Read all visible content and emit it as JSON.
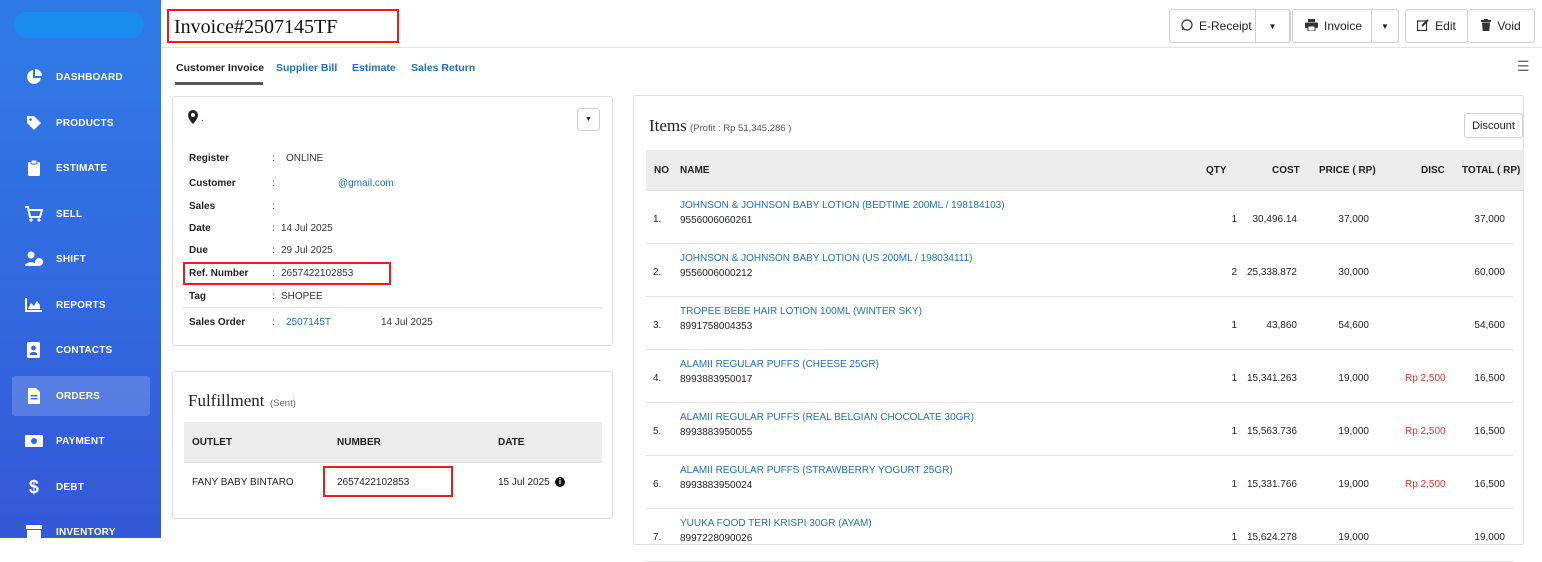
{
  "nav": [
    {
      "label": "DASHBOARD",
      "icon": "pie-chart-icon"
    },
    {
      "label": "PRODUCTS",
      "icon": "tag-icon"
    },
    {
      "label": "ESTIMATE",
      "icon": "clipboard-icon"
    },
    {
      "label": "SELL",
      "icon": "cart-icon"
    },
    {
      "label": "SHIFT",
      "icon": "user-clock-icon"
    },
    {
      "label": "REPORTS",
      "icon": "area-chart-icon"
    },
    {
      "label": "CONTACTS",
      "icon": "address-book-icon"
    },
    {
      "label": "ORDERS",
      "icon": "file-icon"
    },
    {
      "label": "PAYMENT",
      "icon": "money-icon"
    },
    {
      "label": "DEBT",
      "icon": "dollar-icon"
    },
    {
      "label": "INVENTORY",
      "icon": "archive-icon"
    }
  ],
  "header": {
    "title": "Invoice#2507145TF",
    "ereceipt": "E-Receipt",
    "invoice": "Invoice",
    "edit": "Edit",
    "void": "Void"
  },
  "tabs": [
    "Customer Invoice",
    "Supplier Bill",
    "Estimate",
    "Sales Return"
  ],
  "info": {
    "location": ".",
    "register_label": "Register",
    "register": "ONLINE",
    "customer_label": "Customer",
    "customer": "@gmail.com",
    "sales_label": "Sales",
    "sales": "",
    "date_label": "Date",
    "date": "14 Jul 2025",
    "due_label": "Due",
    "due": "29 Jul 2025",
    "ref_label": "Ref. Number",
    "ref": "2657422102853",
    "tag_label": "Tag",
    "tag": "SHOPEE",
    "so_label": "Sales Order",
    "so": "2507145T",
    "so_date": "14 Jul 2025",
    "sep": ":"
  },
  "fulfillment": {
    "title": "Fulfillment",
    "status": "(Sent)",
    "headers": [
      "OUTLET",
      "NUMBER",
      "DATE"
    ],
    "outlet": "FANY BABY BINTARO",
    "number": "2657422102853",
    "date": "15 Jul 2025"
  },
  "items": {
    "title": "Items",
    "profit": "(Profit : Rp 51,345.286 )",
    "discount_btn": "Discount",
    "headers": [
      "NO",
      "NAME",
      "QTY",
      "COST",
      "PRICE ( RP)",
      "DISC",
      "TOTAL ( RP)"
    ],
    "rows": [
      {
        "no": "1.",
        "name": "JOHNSON & JOHNSON BABY LOTION (BEDTIME 200ML / 198184103)",
        "sku": "9556006060261",
        "qty": "1",
        "cost": "30,496.14",
        "price": "37,000",
        "disc": "",
        "total": "37,000"
      },
      {
        "no": "2.",
        "name": "JOHNSON & JOHNSON BABY LOTION (US 200ML / 198034111)",
        "sku": "9556006000212",
        "qty": "2",
        "cost": "25,338.872",
        "price": "30,000",
        "disc": "",
        "total": "60,000"
      },
      {
        "no": "3.",
        "name": "TROPEE BEBE HAIR LOTION 100ML (WINTER SKY)",
        "sku": "8991758004353",
        "qty": "1",
        "cost": "43,860",
        "price": "54,600",
        "disc": "",
        "total": "54,600"
      },
      {
        "no": "4.",
        "name": "ALAMII REGULAR PUFFS (CHEESE 25GR)",
        "sku": "8993883950017",
        "qty": "1",
        "cost": "15,341.263",
        "price": "19,000",
        "disc": "Rp 2,500",
        "total": "16,500"
      },
      {
        "no": "5.",
        "name": "ALAMII REGULAR PUFFS (REAL BELGIAN CHOCOLATE 30GR)",
        "sku": "8993883950055",
        "qty": "1",
        "cost": "15,563.736",
        "price": "19,000",
        "disc": "Rp 2,500",
        "total": "16,500"
      },
      {
        "no": "6.",
        "name": "ALAMII REGULAR PUFFS (STRAWBERRY YOGURT 25GR)",
        "sku": "8993883950024",
        "qty": "1",
        "cost": "15,331.766",
        "price": "19,000",
        "disc": "Rp 2,500",
        "total": "16,500"
      },
      {
        "no": "7.",
        "name": "YUUKA FOOD TERI KRISPI 30GR (AYAM)",
        "sku": "8997228090026",
        "qty": "1",
        "cost": "15,624.278",
        "price": "19,000",
        "disc": "",
        "total": "19,000"
      }
    ]
  }
}
